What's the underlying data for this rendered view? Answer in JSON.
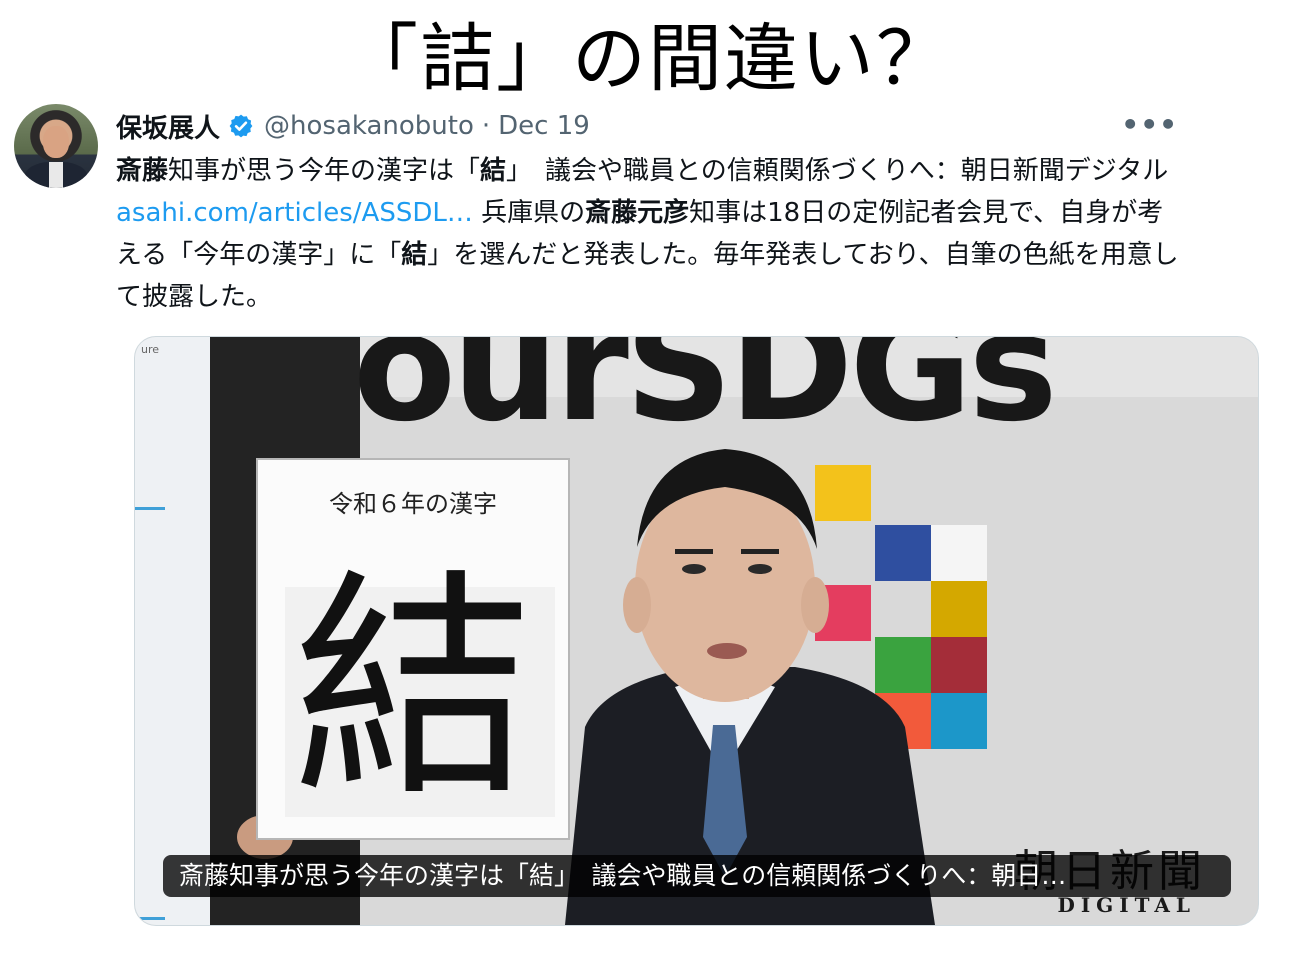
{
  "headline": "「詰」の間違い？",
  "tweet": {
    "display_name": "保坂展人",
    "handle": "@hosakanobuto",
    "separator": "·",
    "date": "Dec 19",
    "more_label": "•••",
    "text_segments": [
      {
        "text": "斎藤",
        "bold": true
      },
      {
        "text": "知事が思う今年の漢字は「",
        "bold": false
      },
      {
        "text": "結",
        "bold": true
      },
      {
        "text": "」　議会や職員との信頼関係づくりへ：朝日新聞デジタル ",
        "bold": false
      },
      {
        "text": "asahi.com/articles/ASSDL…",
        "link": true
      },
      {
        "text": " 兵庫県の",
        "bold": false
      },
      {
        "text": "斎藤元彦",
        "bold": true
      },
      {
        "text": "知事は18日の定例記者会見で、自身が考える「今年の漢字」に「",
        "bold": false
      },
      {
        "text": "結",
        "bold": true
      },
      {
        "text": "」を選んだと発表した。毎年発表しており、自筆の色紙を用意して披露した。",
        "bold": false
      }
    ]
  },
  "card": {
    "backdrop_text": "ourSDGs",
    "board_heading": "令和６年の漢字",
    "board_character": "結",
    "caption": "斎藤知事が思う今年の漢字は「結」　議会や職員との信頼関係づくりへ：朝日…",
    "watermark_main": "朝日新聞",
    "watermark_sub": "DIGITAL",
    "backdrop_fragment": "ure"
  },
  "colors": {
    "link": "#1d9bf0",
    "verified": "#1d9bf0",
    "secondary_text": "#536471"
  }
}
